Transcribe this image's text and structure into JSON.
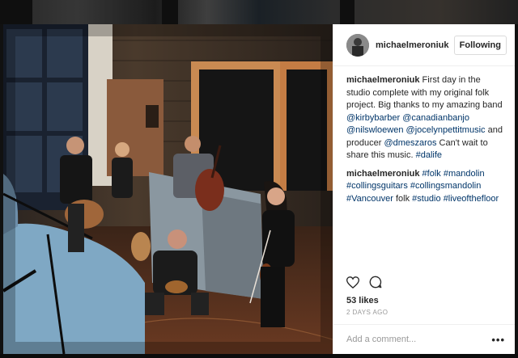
{
  "post": {
    "username": "michaelmeroniuk",
    "follow_label": "Following",
    "caption": {
      "username": "michaelmeroniuk",
      "text_1": "First day in the studio complete with my original folk project. Big thanks to my amazing band ",
      "mentions": [
        "@kirbybarber",
        "@canadianbanjo",
        "@nilswloewen",
        "@jocelynpettitmusic"
      ],
      "text_2": " and producer ",
      "producer": "@dmeszaros",
      "text_3": " Can't wait to share this music. ",
      "hashtag": "#dalife"
    },
    "comment": {
      "username": "michaelmeroniuk",
      "tags_1": [
        "#folk",
        "#mandolin",
        "#collingsguitars",
        "#collingsmandolin",
        "#Vancouver"
      ],
      "word": "folk",
      "tags_2": [
        "#studio",
        "#liveofthefloor"
      ]
    },
    "likes": "53 likes",
    "time": "2 DAYS AGO",
    "add_comment_placeholder": "Add a comment...",
    "more_label": "•••"
  },
  "icons": {
    "like": "heart-icon",
    "comment": "comment-icon",
    "more": "more-options-icon"
  }
}
